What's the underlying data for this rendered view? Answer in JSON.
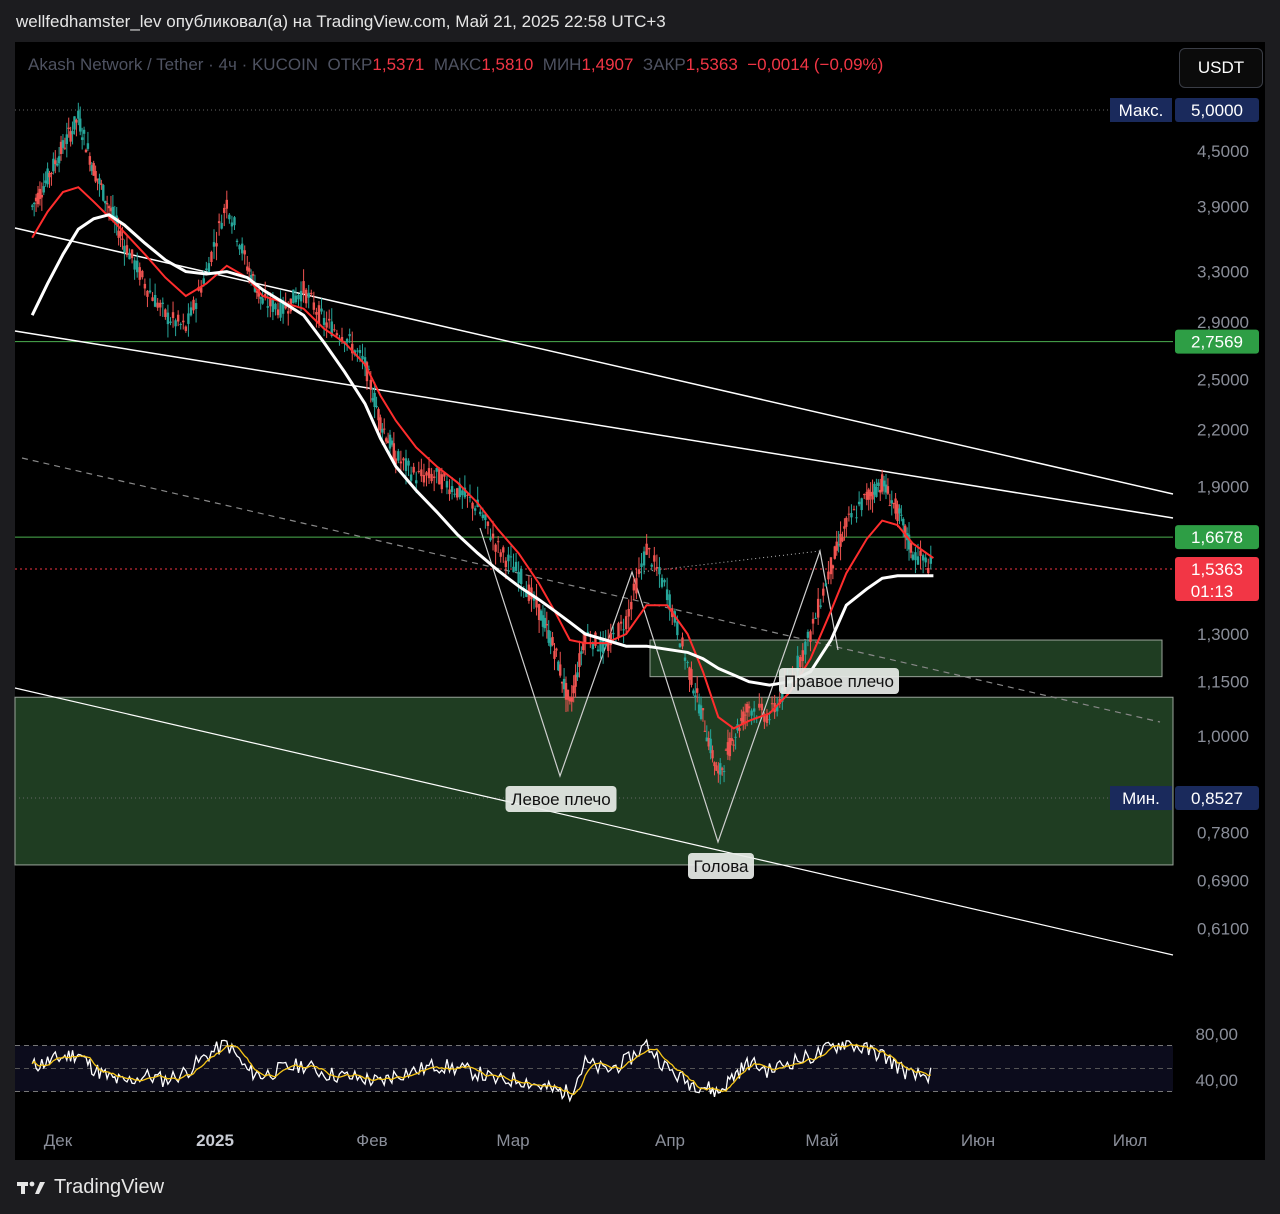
{
  "header": {
    "published_line": "wellfedhamster_lev опубликовал(а) на TradingView.com, Май 21, 2025 22:58 UTC+3"
  },
  "legend": {
    "symbol": "Akash Network / Tether · 4ч · KUCOIN",
    "open_label": "ОТКР",
    "open": "1,5371",
    "high_label": "МАКС",
    "high": "1,5810",
    "low_label": "МИН",
    "low": "1,4907",
    "close_label": "ЗАКР",
    "close": "1,5363",
    "change": "−0,0014 (−0,09%)"
  },
  "currency_button": "USDT",
  "footer": {
    "brand": "TradingView"
  },
  "colors": {
    "background": "#000000",
    "candle_up": "#26a69a",
    "candle_down": "#ef5350",
    "ema_fast": "#ff2d2d",
    "ema_white": "#ffffff",
    "zone_green": "#1f3d22",
    "level_green": "#4caf50",
    "price_red": "#f23645",
    "rsi_line": "#ffffff",
    "rsi_ma": "#f5c518"
  },
  "chart_data": [
    {
      "type": "line",
      "name": "price",
      "scale": "log",
      "x_ticks": [
        "Дек",
        "2025",
        "Фев",
        "Мар",
        "Апр",
        "Май",
        "Июн",
        "Июл"
      ],
      "y_ticks": [
        "4,5000",
        "3,9000",
        "3,3000",
        "2,9000",
        "2,5000",
        "2,2000",
        "1,9000",
        "1,3000",
        "1,1500",
        "1,0000",
        "0,7800",
        "0,6900",
        "0,6100"
      ],
      "ylim": [
        0.55,
        5.6
      ],
      "x": [
        "2024-11-26",
        "2024-11-29",
        "2024-12-02",
        "2024-12-05",
        "2024-12-08",
        "2024-12-11",
        "2024-12-14",
        "2024-12-18",
        "2024-12-22",
        "2024-12-26",
        "2024-12-30",
        "2025-01-03",
        "2025-01-07",
        "2025-01-10",
        "2025-01-14",
        "2025-01-18",
        "2025-01-22",
        "2025-01-26",
        "2025-01-30",
        "2025-02-02",
        "2025-02-05",
        "2025-02-09",
        "2025-02-13",
        "2025-02-17",
        "2025-02-21",
        "2025-02-25",
        "2025-03-01",
        "2025-03-05",
        "2025-03-08",
        "2025-03-11",
        "2025-03-14",
        "2025-03-18",
        "2025-03-22",
        "2025-03-26",
        "2025-03-30",
        "2025-04-03",
        "2025-04-06",
        "2025-04-09",
        "2025-04-12",
        "2025-04-15",
        "2025-04-19",
        "2025-04-23",
        "2025-04-27",
        "2025-05-01",
        "2025-05-04",
        "2025-05-08",
        "2025-05-11",
        "2025-05-14",
        "2025-05-17",
        "2025-05-21"
      ],
      "close": [
        3.9,
        4.2,
        4.55,
        4.9,
        4.3,
        3.9,
        3.55,
        3.2,
        2.95,
        2.85,
        3.3,
        3.95,
        3.35,
        3.05,
        3.0,
        3.15,
        2.9,
        2.8,
        2.6,
        2.25,
        2.05,
        1.95,
        1.95,
        1.88,
        1.8,
        1.62,
        1.52,
        1.38,
        1.25,
        1.08,
        1.3,
        1.25,
        1.35,
        1.62,
        1.45,
        1.2,
        1.05,
        0.9,
        1.0,
        1.08,
        1.05,
        1.15,
        1.3,
        1.55,
        1.72,
        1.85,
        1.92,
        1.78,
        1.6,
        1.54
      ],
      "series": [
        {
          "name": "EMA",
          "values": [
            3.6,
            3.85,
            4.05,
            4.1,
            3.95,
            3.8,
            3.65,
            3.45,
            3.25,
            3.1,
            3.2,
            3.35,
            3.25,
            3.1,
            3.05,
            3.0,
            2.85,
            2.75,
            2.6,
            2.4,
            2.25,
            2.1,
            2.0,
            1.92,
            1.82,
            1.7,
            1.6,
            1.48,
            1.38,
            1.28,
            1.27,
            1.27,
            1.3,
            1.4,
            1.4,
            1.3,
            1.18,
            1.05,
            1.02,
            1.04,
            1.06,
            1.12,
            1.22,
            1.38,
            1.52,
            1.66,
            1.74,
            1.72,
            1.64,
            1.58
          ]
        },
        {
          "name": "MA",
          "values": [
            2.95,
            3.2,
            3.45,
            3.68,
            3.78,
            3.82,
            3.72,
            3.55,
            3.4,
            3.3,
            3.28,
            3.3,
            3.25,
            3.15,
            3.05,
            2.95,
            2.75,
            2.55,
            2.35,
            2.15,
            2.0,
            1.88,
            1.78,
            1.68,
            1.6,
            1.53,
            1.47,
            1.42,
            1.38,
            1.34,
            1.3,
            1.28,
            1.26,
            1.26,
            1.25,
            1.24,
            1.22,
            1.19,
            1.17,
            1.15,
            1.14,
            1.15,
            1.18,
            1.28,
            1.4,
            1.46,
            1.5,
            1.51,
            1.51,
            1.51
          ]
        }
      ],
      "levels": [
        {
          "label": "Макс.",
          "value": "5,0000"
        },
        {
          "label": "",
          "value": "2,7569"
        },
        {
          "label": "",
          "value": "1,6678"
        },
        {
          "label": "",
          "value": "1,5363",
          "timer": "01:13"
        },
        {
          "label": "Мин.",
          "value": "0,8527"
        }
      ],
      "annotations": [
        "Левое плечо",
        "Голова",
        "Правое плечо"
      ]
    },
    {
      "type": "line",
      "name": "RSI",
      "y_ticks": [
        "80,00",
        "40,00"
      ],
      "ylim": [
        20,
        90
      ],
      "bands": [
        70,
        30
      ],
      "values": [
        52,
        56,
        60,
        63,
        50,
        42,
        38,
        44,
        40,
        47,
        61,
        72,
        48,
        44,
        50,
        53,
        46,
        43,
        41,
        38,
        45,
        48,
        53,
        50,
        46,
        39,
        41,
        35,
        31,
        29,
        55,
        48,
        56,
        71,
        50,
        38,
        35,
        29,
        44,
        55,
        48,
        56,
        60,
        68,
        73,
        66,
        62,
        52,
        43,
        45
      ]
    }
  ]
}
